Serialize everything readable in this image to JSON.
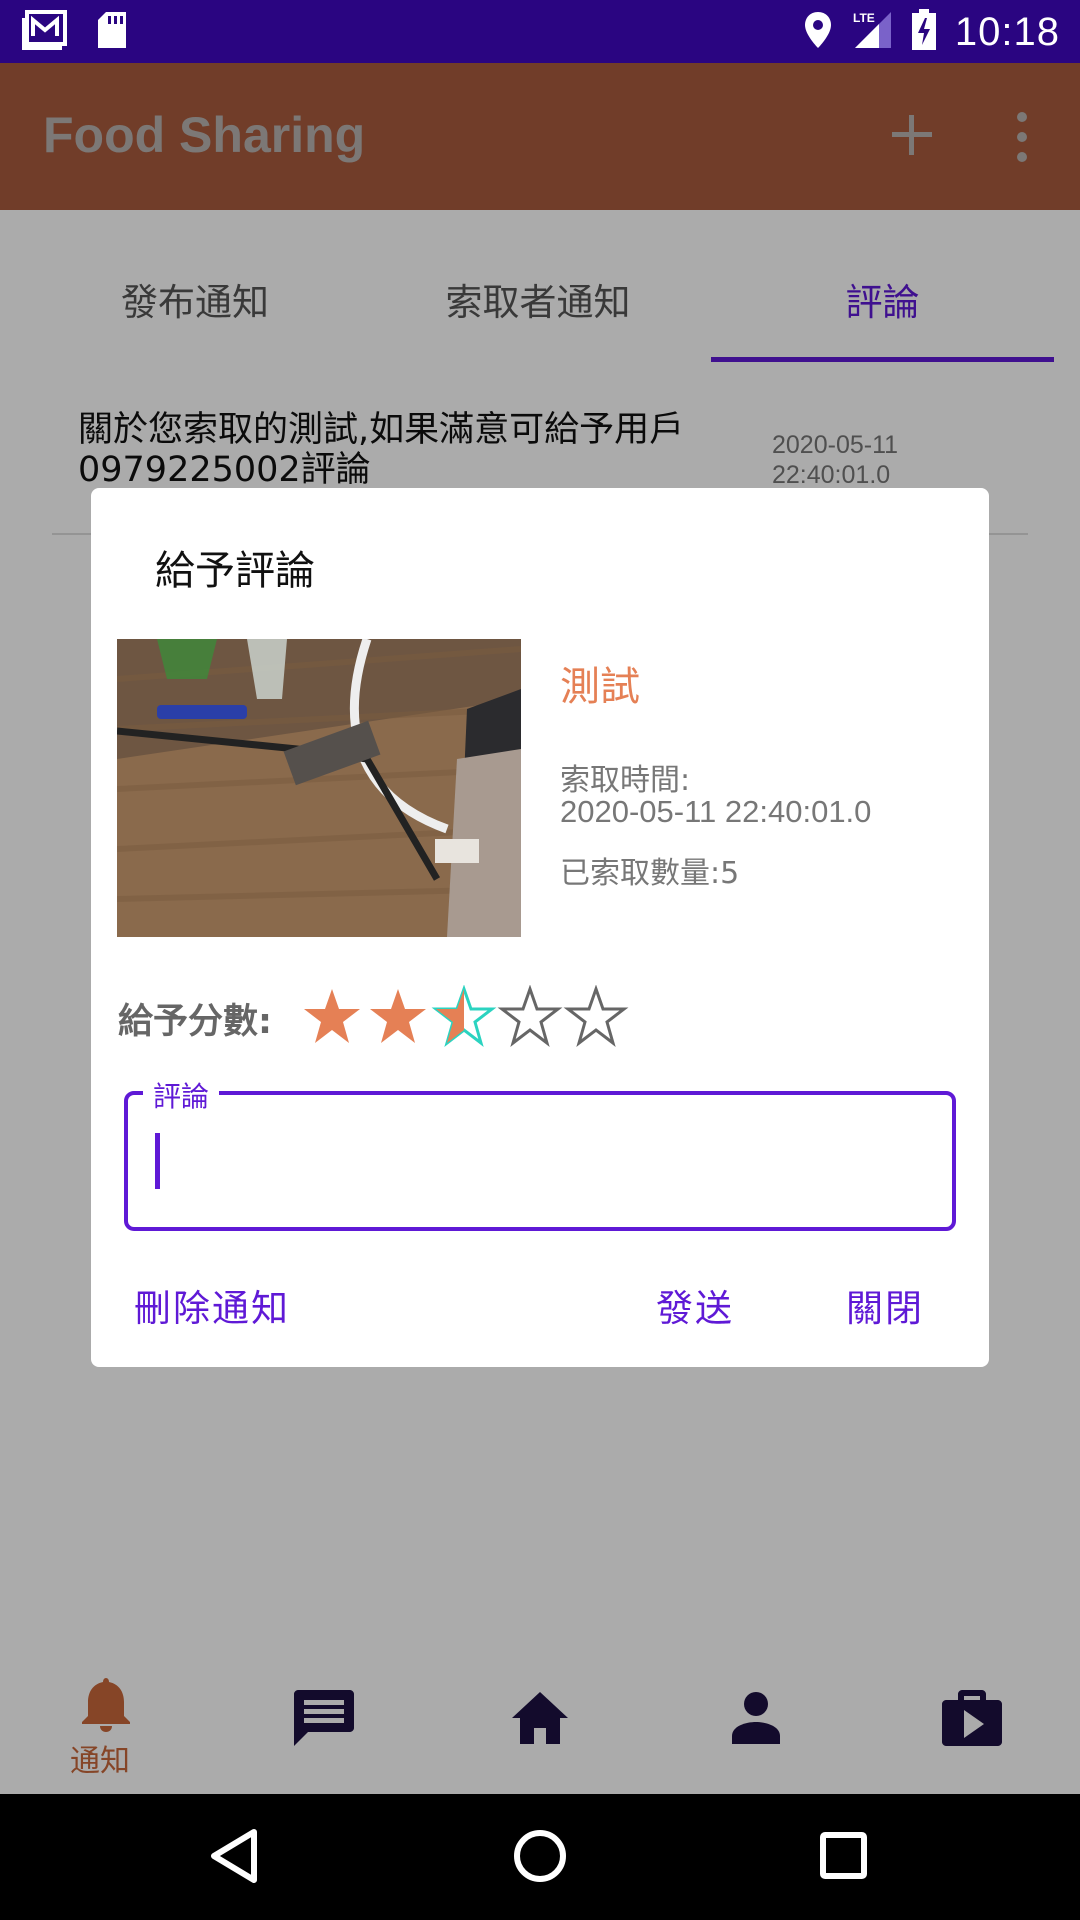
{
  "status_bar": {
    "time": "10:18",
    "icons": [
      "gmail-icon",
      "sd-card-icon",
      "location-icon",
      "lte-signal-icon",
      "battery-charging-icon"
    ]
  },
  "app_bar": {
    "title": "Food Sharing",
    "actions": [
      "add-icon",
      "more-vert-icon"
    ]
  },
  "tabs": [
    {
      "label": "發布通知",
      "active": false
    },
    {
      "label": "索取者通知",
      "active": false
    },
    {
      "label": "評論",
      "active": true
    }
  ],
  "notification": {
    "text": "關於您索取的測試,如果滿意可給予用戶0979225002評論",
    "date": "2020-05-11",
    "time": "22:40:01.0"
  },
  "dialog": {
    "title": "給予評論",
    "item_name": "測試",
    "time_label": "索取時間:",
    "time_value": "2020-05-11 22:40:01.0",
    "quantity": "已索取數量:5",
    "score_label": "給予分數:",
    "rating": 2.5,
    "max_rating": 5,
    "comment_label": "評論",
    "comment_value": "",
    "buttons": {
      "delete": "刪除通知",
      "send": "發送",
      "close": "關閉"
    }
  },
  "bottom_nav": {
    "items": [
      "bell-icon",
      "chat-icon",
      "home-icon",
      "person-icon",
      "shop-icon"
    ],
    "active_label": "通知"
  },
  "colors": {
    "status_bar": "#2a0581",
    "app_bar": "#a95c3e",
    "accent": "#5f19d6",
    "star": "#e58055"
  }
}
